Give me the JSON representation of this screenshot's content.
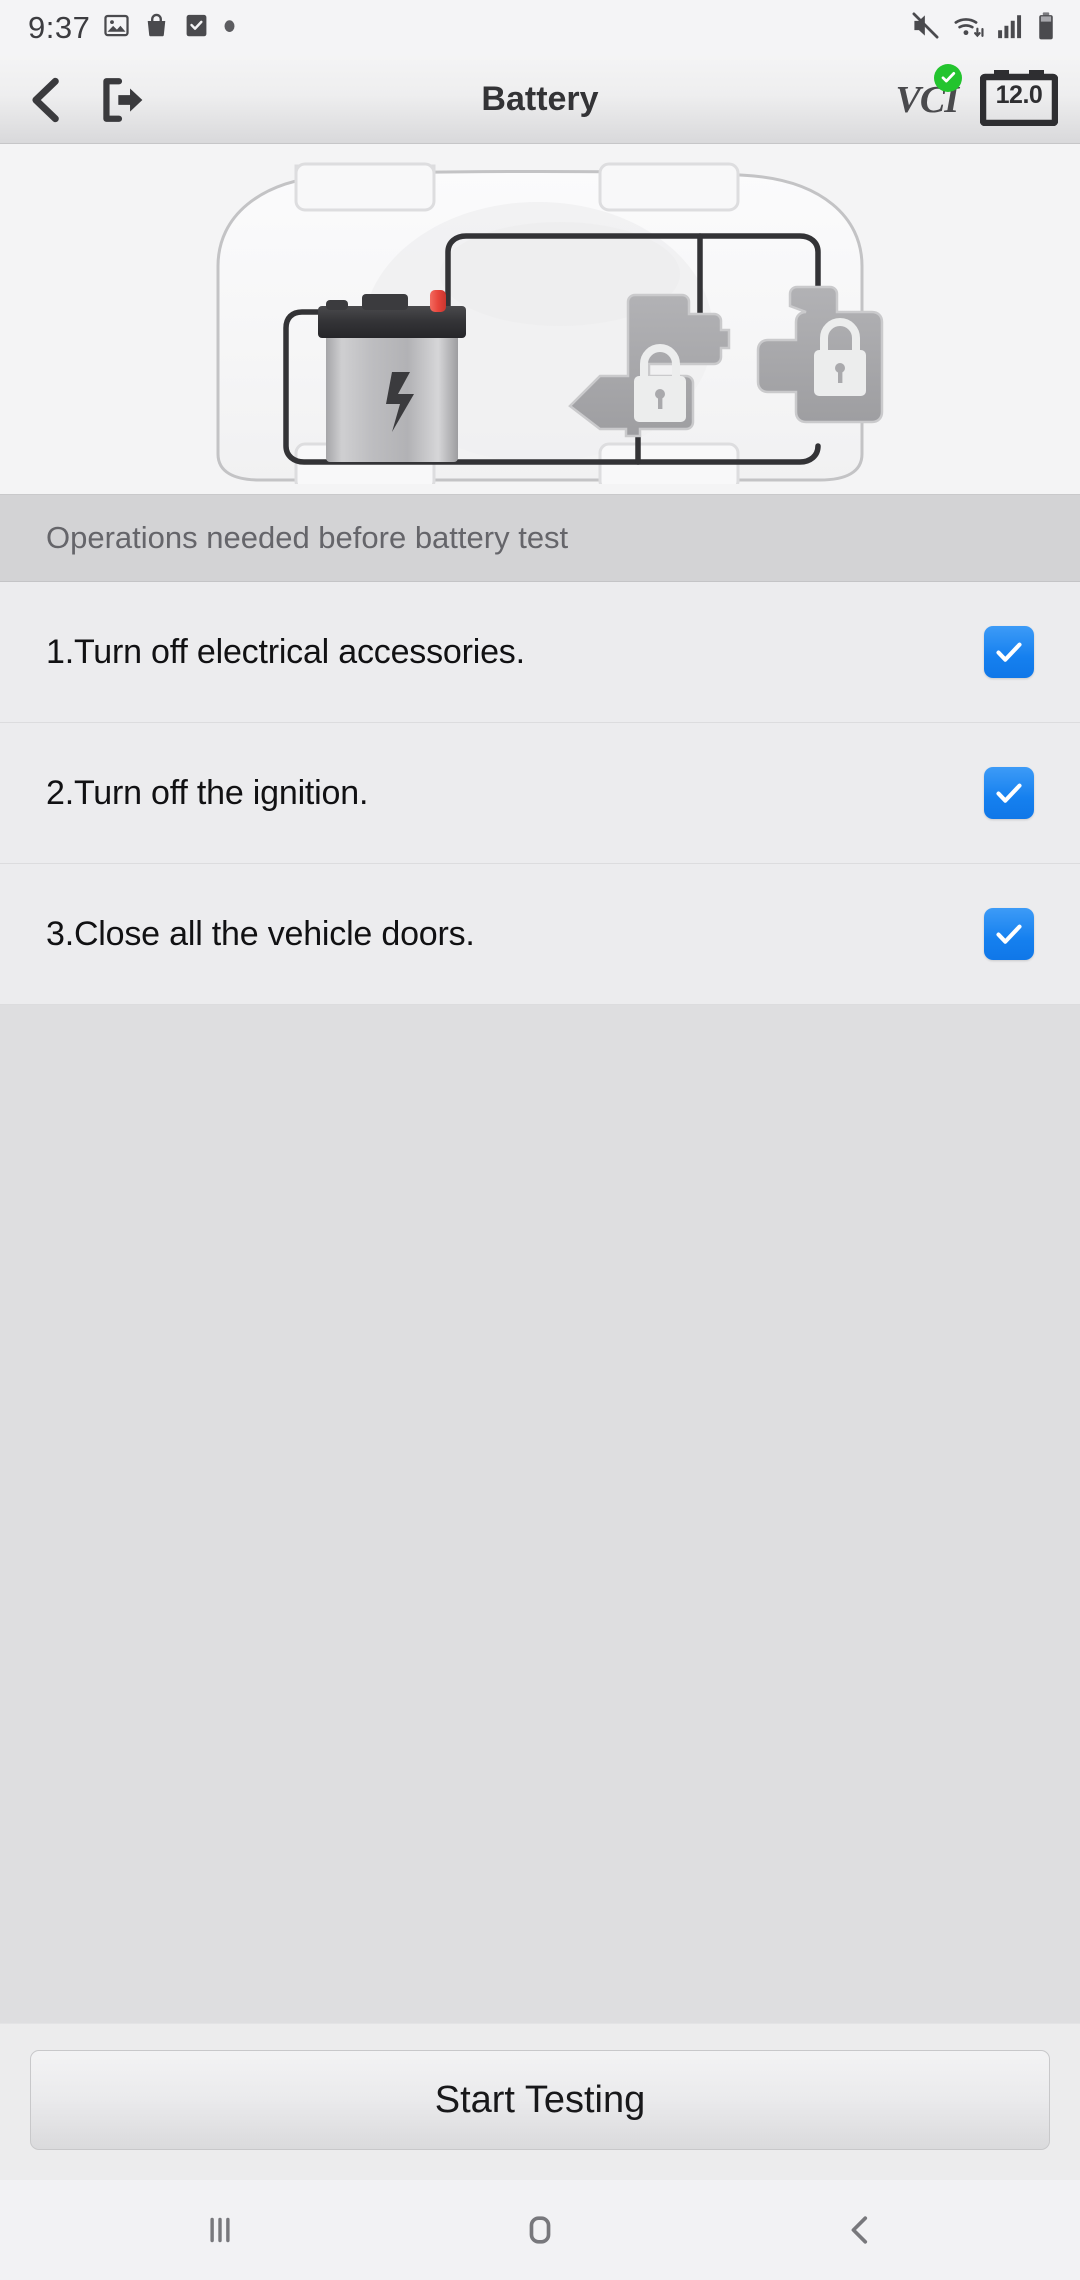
{
  "status_bar": {
    "time": "9:37",
    "left_icons": [
      "image-icon",
      "shopping-bag-icon",
      "checkbox-app-icon",
      "dot-icon"
    ],
    "right_icons": [
      "mute-icon",
      "wifi-icon",
      "cellular-signal-icon",
      "battery-icon"
    ]
  },
  "header": {
    "title": "Battery",
    "back_icon": "chevron-left-icon",
    "exit_icon": "exit-arrow-icon",
    "vci_label": "VCI",
    "vci_status_icon": "check-circle-icon",
    "vci_status_color": "#23c42e",
    "battery_voltage": "12.0",
    "battery_icon": "car-battery-icon"
  },
  "illustration": {
    "name": "vehicle-battery-wiring-diagram",
    "elements": [
      "vehicle-outline",
      "car-battery",
      "locked-module-center",
      "locked-module-right",
      "wiring-harness"
    ],
    "wire_color": "#333333",
    "positive_terminal_color": "#e8453c"
  },
  "section": {
    "header": "Operations needed before battery test"
  },
  "checklist": [
    {
      "label": "1.Turn off electrical accessories.",
      "checked": true
    },
    {
      "label": "2.Turn off the ignition.",
      "checked": true
    },
    {
      "label": "3.Close all the vehicle doors.",
      "checked": true
    }
  ],
  "footer": {
    "start_button": "Start Testing"
  },
  "nav_bar": {
    "recents_icon": "recent-apps-icon",
    "home_icon": "home-icon",
    "back_icon": "nav-back-icon"
  },
  "colors": {
    "accent": "#1580ef",
    "section_bg": "#d3d3d5",
    "row_bg": "#ececee",
    "page_bg": "#dedee0",
    "text_primary": "#111113",
    "text_secondary": "#65656a"
  }
}
